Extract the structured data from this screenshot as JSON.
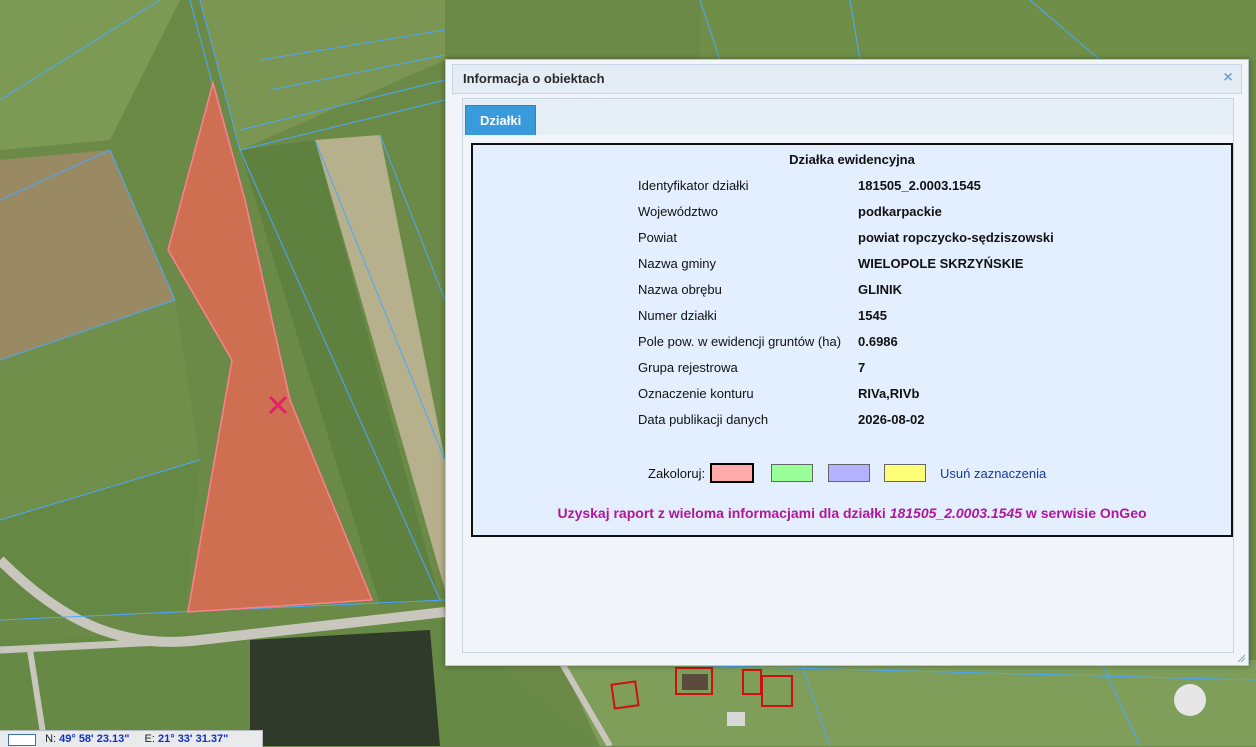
{
  "dialog": {
    "title": "Informacja o obiektach",
    "close_symbol": "×"
  },
  "tabs": [
    {
      "label": "Działki",
      "active": true
    }
  ],
  "info": {
    "heading": "Działka ewidencyjna",
    "rows": [
      {
        "label": "Identyfikator działki",
        "value": "181505_2.0003.1545"
      },
      {
        "label": "Województwo",
        "value": "podkarpackie"
      },
      {
        "label": "Powiat",
        "value": "powiat ropczycko-sędziszowski"
      },
      {
        "label": "Nazwa gminy",
        "value": "WIELOPOLE SKRZYŃSKIE"
      },
      {
        "label": "Nazwa obrębu",
        "value": "GLINIK"
      },
      {
        "label": "Numer działki",
        "value": "1545"
      },
      {
        "label": "Pole pow. w ewidencji gruntów (ha)",
        "value": "0.6986"
      },
      {
        "label": "Grupa rejestrowa",
        "value": "7"
      },
      {
        "label": "Oznaczenie konturu",
        "value": "RIVa,RIVb"
      },
      {
        "label": "Data publikacji danych",
        "value": "2026-08-02"
      }
    ],
    "colorize": {
      "label": "Zakoloruj:",
      "swatches": [
        "#ffaaaa",
        "#99ff99",
        "#b3b3ff",
        "#ffff77"
      ],
      "selected_index": 0,
      "clear_label": "Usuń zaznaczenia"
    },
    "report": {
      "prefix": "Uzyskaj raport z wieloma informacjami dla działki ",
      "parcel_id": "181505_2.0003.1545",
      "suffix": " w serwisie OnGeo"
    }
  },
  "statusbar": {
    "n_label": "N:",
    "n_value": "49° 58' 23.13\"",
    "e_label": "E:",
    "e_value": "21° 33' 31.37\""
  },
  "colors": {
    "parcel_highlight": "#e06a55",
    "parcel_lines": "#4aa8ff",
    "accent": "#3a9bdc",
    "report_link": "#b0179a"
  }
}
